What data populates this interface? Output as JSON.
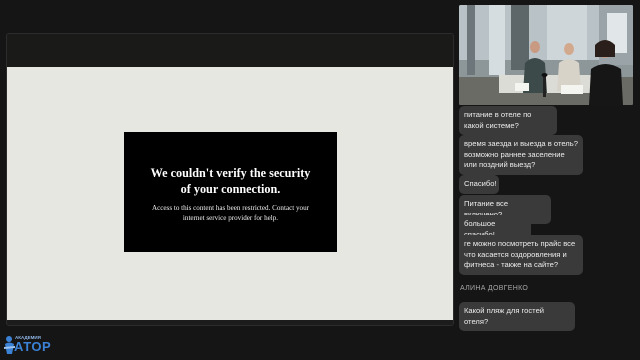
{
  "notice": {
    "heading": "We couldn't verify the security of your connection.",
    "body": "Access to this content has been restricted. Contact your internet service provider for help."
  },
  "chat": {
    "messages": [
      {
        "text": "питание в отеле по какой системе?"
      },
      {
        "text": "время заезда и выезда в отель? возможно раннее заселение или поздний выезд?"
      },
      {
        "text": "Спасибо!"
      },
      {
        "text": "Питание все включено?"
      },
      {
        "text": "большое спасибо!"
      },
      {
        "text": "ге можно посмотреть прайс все что касается оздоровления и фитнеса - также на сайте?"
      },
      {
        "author": "АЛИНА ДОВГЕНКО"
      },
      {
        "text": "Какой пляж для гостей отеля?"
      }
    ]
  },
  "logo": {
    "small": "АКАДЕМИЯ",
    "big": "АТОР"
  },
  "colors": {
    "background": "#151515",
    "slide": "#e7e7e2",
    "bubble": "#3a3a3a",
    "logo": "#3b82d6"
  }
}
